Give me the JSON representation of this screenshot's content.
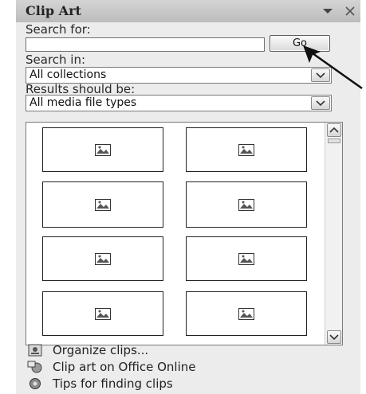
{
  "pane": {
    "title": "Clip Art",
    "dropdown_icon": "triangle-down-icon",
    "close_icon": "close-icon"
  },
  "search": {
    "label": "Search for:",
    "value": "",
    "placeholder": "",
    "go_label": "Go"
  },
  "search_in": {
    "label": "Search in:",
    "selected": "All collections"
  },
  "results_type": {
    "label": "Results should be:",
    "selected": "All media file types"
  },
  "results": {
    "thumbnail_count": 8,
    "placeholder_icon": "broken-image-icon"
  },
  "links": [
    {
      "label": "Organize clips...",
      "icon": "organizer-icon"
    },
    {
      "label": "Clip art on Office Online",
      "icon": "office-online-icon"
    },
    {
      "label": "Tips for finding clips",
      "icon": "help-tips-icon"
    }
  ]
}
